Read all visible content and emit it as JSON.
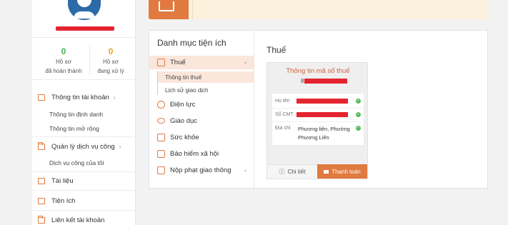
{
  "sidebar": {
    "stats": [
      {
        "value": "0",
        "label_line1": "Hồ sơ",
        "label_line2": "đã hoàn thành",
        "color": "#4caf50"
      },
      {
        "value": "0",
        "label_line1": "Hồ sơ",
        "label_line2": "đang xử lý",
        "color": "#f0a020"
      }
    ],
    "nav": {
      "account_info": "Thông tin tài khoản",
      "identity_info": "Thông tin định danh",
      "extended_info": "Thông tin mở rộng",
      "public_services": "Quản lý dịch vụ công",
      "my_services": "Dịch vụ công của tôi",
      "documents": "Tài liệu",
      "utilities": "Tiện ích",
      "linked_accounts": "Liên kết tài khoản"
    }
  },
  "categories": {
    "title": "Danh mục tiện ích",
    "items": [
      {
        "label": "Thuế",
        "icon": "document-icon"
      },
      {
        "label": "Điện lực",
        "icon": "lightning-icon"
      },
      {
        "label": "Giáo dục",
        "icon": "graduation-cap-icon"
      },
      {
        "label": "Sức khỏe",
        "icon": "medical-icon"
      },
      {
        "label": "Bảo hiểm xã hội",
        "icon": "insurance-icon"
      },
      {
        "label": "Nộp phạt giao thông",
        "icon": "traffic-icon"
      }
    ],
    "tax_sub": [
      "Thông tin thuế",
      "Lịch sử giao dịch"
    ]
  },
  "tax": {
    "heading": "Thuế",
    "card_title": "Thông tin mã số thuế",
    "tax_code_prefix": "8",
    "fields": [
      {
        "label": "Họ tên",
        "value": ""
      },
      {
        "label": "Số CMT",
        "value": ""
      },
      {
        "label": "Địa chỉ",
        "value_line1": "Phương liên, Phường",
        "value_line2": "Phương Liên"
      }
    ],
    "detail_button": "Chi tiết",
    "pay_button": "Thanh toán"
  },
  "colors": {
    "accent": "#e07a40",
    "redaction": "#e4242f",
    "success": "#5cb85c"
  }
}
